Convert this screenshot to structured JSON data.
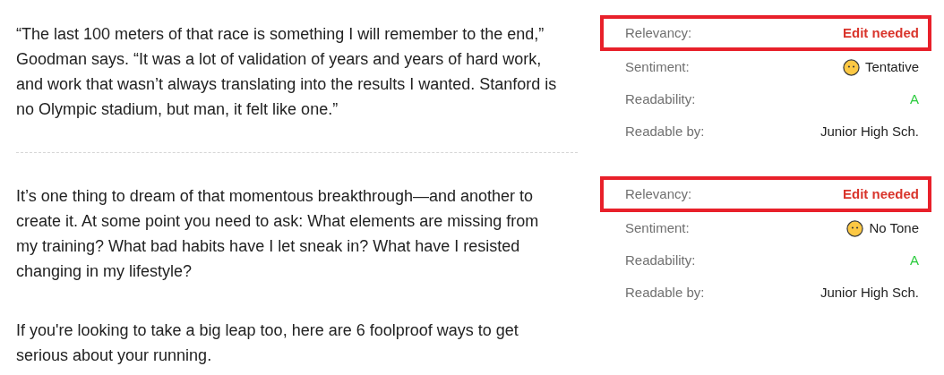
{
  "sections": [
    {
      "paragraphs": [
        "“The last 100 meters of that race is something I will remember to the end,” Goodman says. “It was a lot of validation of years and years of hard work, and work that wasn’t always translating into the results I wanted. Stanford is no Olympic stadium, but man, it felt like one.”"
      ],
      "metrics": [
        {
          "kind": "alert",
          "label": "Relevancy:",
          "value": "Edit needed",
          "highlighted": true
        },
        {
          "kind": "sentiment",
          "label": "Sentiment:",
          "value": "Tentative",
          "highlighted": false
        },
        {
          "kind": "grade",
          "label": "Readability:",
          "value": "A",
          "highlighted": false
        },
        {
          "kind": "plain",
          "label": "Readable by:",
          "value": "Junior High Sch.",
          "highlighted": false
        }
      ]
    },
    {
      "paragraphs": [
        "It’s one thing to dream of that momentous breakthrough—and another to create it. At some point you need to ask: What elements are missing from my training? What bad habits have I let sneak in? What have I resisted changing in my lifestyle?",
        "If you're looking to take a big leap too, here are 6 foolproof ways to get serious about your running."
      ],
      "metrics": [
        {
          "kind": "alert",
          "label": "Relevancy:",
          "value": "Edit needed",
          "highlighted": true
        },
        {
          "kind": "sentiment",
          "label": "Sentiment:",
          "value": "No Tone",
          "highlighted": false
        },
        {
          "kind": "grade",
          "label": "Readability:",
          "value": "A",
          "highlighted": false
        },
        {
          "kind": "plain",
          "label": "Readable by:",
          "value": "Junior High Sch.",
          "highlighted": false
        }
      ]
    }
  ]
}
